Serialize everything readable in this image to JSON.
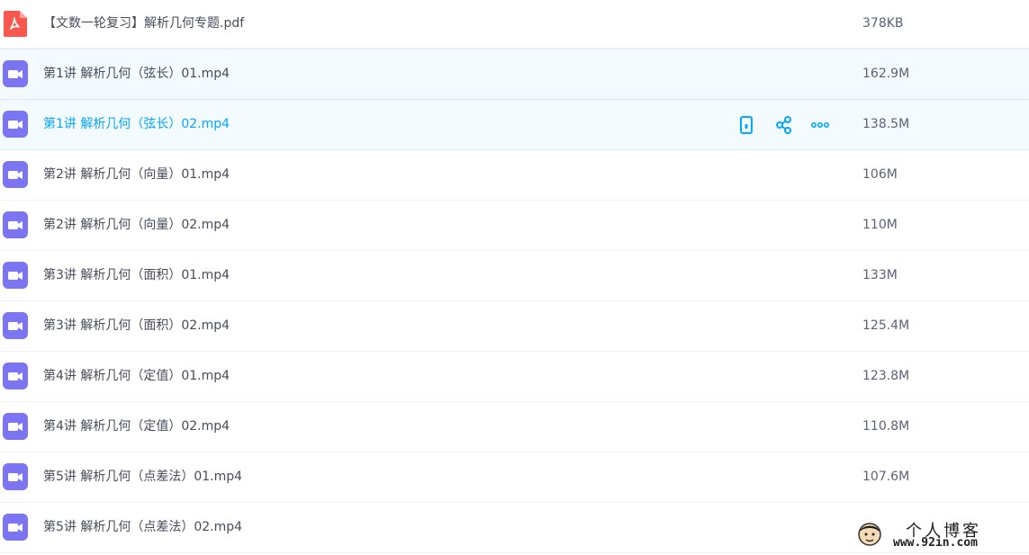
{
  "colors": {
    "video_icon": "#7b74f3",
    "pdf_icon": "#f8584f",
    "active_text": "#06a7ff",
    "action_icon": "#06a7ff"
  },
  "files": [
    {
      "name": "【文数一轮复习】解析几何专题.pdf",
      "size": "378KB",
      "type": "pdf-icon"
    },
    {
      "name": "第1讲 解析几何（弦长）01.mp4",
      "size": "162.9M",
      "type": "video-icon"
    },
    {
      "name": "第1讲 解析几何（弦长）02.mp4",
      "size": "138.5M",
      "type": "video-icon"
    },
    {
      "name": "第2讲 解析几何（向量）01.mp4",
      "size": "106M",
      "type": "video-icon"
    },
    {
      "name": "第2讲 解析几何（向量）02.mp4",
      "size": "110M",
      "type": "video-icon"
    },
    {
      "name": "第3讲 解析几何（面积）01.mp4",
      "size": "133M",
      "type": "video-icon"
    },
    {
      "name": "第3讲 解析几何（面积）02.mp4",
      "size": "125.4M",
      "type": "video-icon"
    },
    {
      "name": "第4讲 解析几何（定值）01.mp4",
      "size": "123.8M",
      "type": "video-icon"
    },
    {
      "name": "第4讲 解析几何（定值）02.mp4",
      "size": "110.8M",
      "type": "video-icon"
    },
    {
      "name": "第5讲 解析几何（点差法）01.mp4",
      "size": "107.6M",
      "type": "video-icon"
    },
    {
      "name": "第5讲 解析几何（点差法）02.mp4",
      "size": "",
      "type": "video-icon"
    }
  ],
  "row_actions": [
    {
      "icon": "phone-icon"
    },
    {
      "icon": "share-icon"
    },
    {
      "icon": "more-icon"
    }
  ],
  "watermark": {
    "title": "个人博客",
    "url": "www.92in.com"
  }
}
